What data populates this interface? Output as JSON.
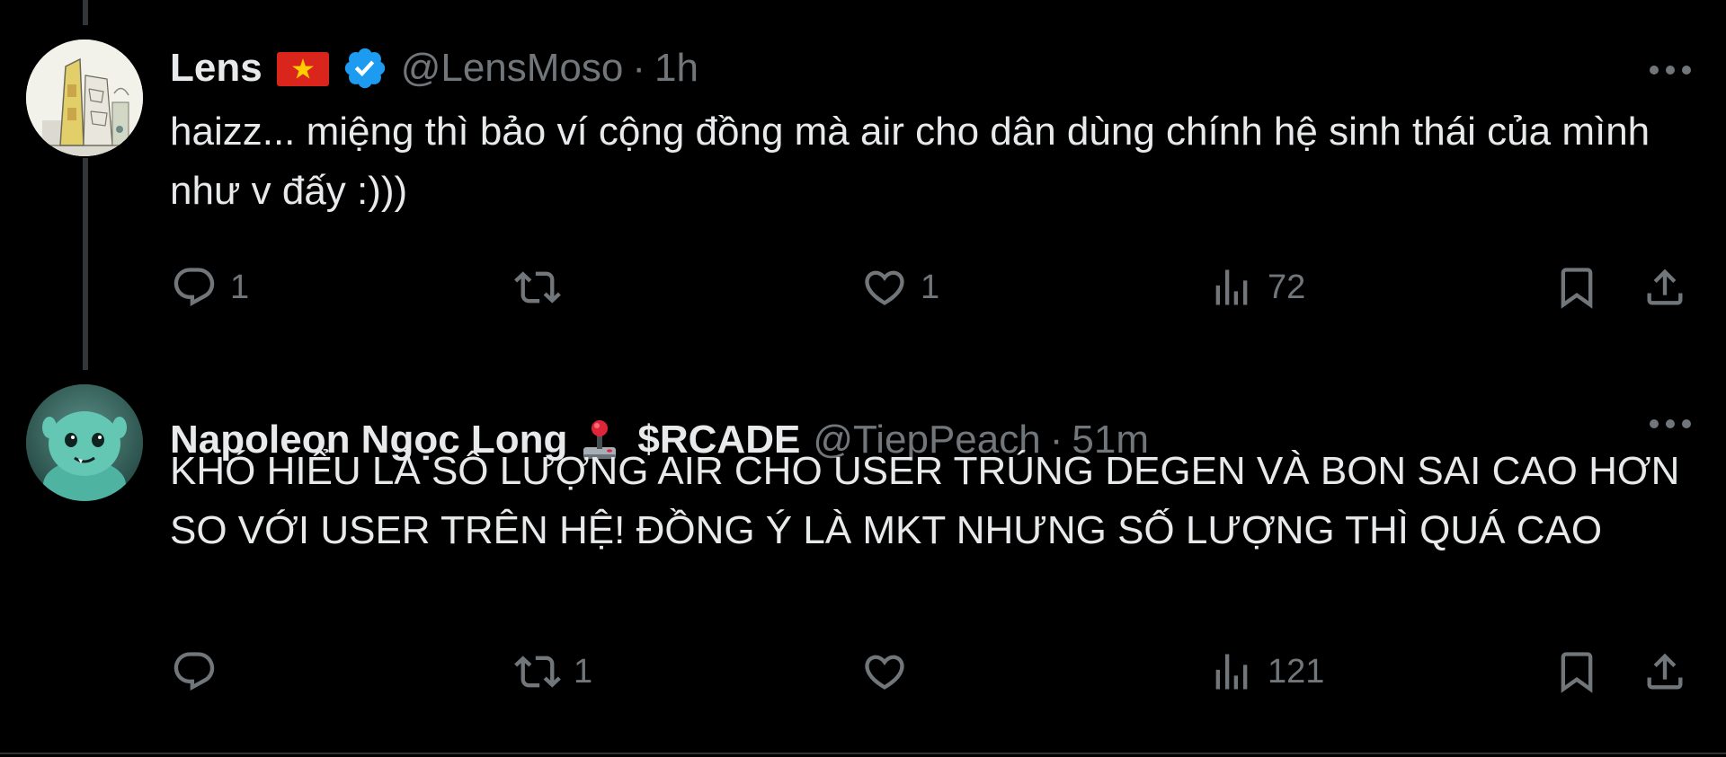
{
  "colors": {
    "background": "#000000",
    "primary_text": "#e7e9ea",
    "secondary_text": "#71767b",
    "verified_blue": "#1d9bf0",
    "thread_line": "#333639"
  },
  "tweets": [
    {
      "display_name": "Lens",
      "flag_icon": "vietnam-flag-icon",
      "verified_icon": "verified-badge-icon",
      "handle": "@LensMoso",
      "separator": "·",
      "time": "1h",
      "text": "haizz... miệng thì bảo ví cộng đồng mà air cho dân dùng chính hệ sinh thái của mình như v đấy :)))",
      "reply_count": "1",
      "retweet_count": "",
      "like_count": "1",
      "view_count": "72"
    },
    {
      "display_name": "Napoleon Ngọc Long",
      "joystick_icon": "joystick-icon",
      "ticker": "$RCADE",
      "handle": "@TiepPeach",
      "separator": "·",
      "time": "51m",
      "text": "KHÓ HIỂU LÀ SỐ LƯỢNG AIR CHO USER TRÚNG DEGEN VÀ BON SAI CAO HƠN SO VỚI USER TRÊN HỆ! ĐỒNG Ý LÀ MKT NHƯNG SỐ LƯỢNG THÌ QUÁ CAO",
      "reply_count": "",
      "retweet_count": "1",
      "like_count": "",
      "view_count": "121"
    }
  ]
}
